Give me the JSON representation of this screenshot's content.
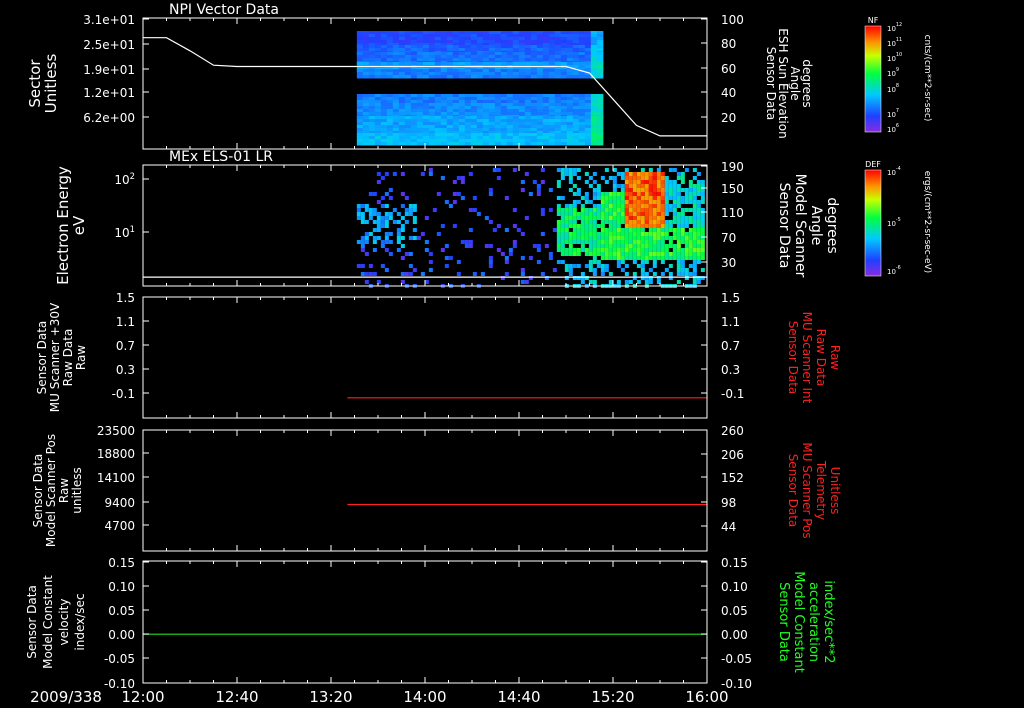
{
  "date_label": "2009/338",
  "x_ticks": [
    "12:00",
    "12:40",
    "13:20",
    "14:00",
    "14:40",
    "15:20",
    "16:00"
  ],
  "panels": [
    {
      "title": "NPI Vector Data",
      "ylabel_left": [
        "Sector",
        "Unitless"
      ],
      "yticks_left": [
        "3.1e+01",
        "2.5e+01",
        "1.9e+01",
        "1.2e+01",
        "6.2e+00"
      ],
      "ylabel_right": [
        "Sensor Data",
        "ESH Sun Elevation",
        "Angle",
        "degrees"
      ],
      "yticks_right": [
        "100",
        "80",
        "60",
        "40",
        "20"
      ],
      "colorbar": {
        "label": "NF",
        "units": "cnts/(cm**2-sr-sec)",
        "ticks": [
          "10^12",
          "10^11",
          "10^10",
          "10^9",
          "10^8",
          "10^7",
          "10^6"
        ]
      }
    },
    {
      "title": "MEx ELS-01 LR",
      "ylabel_left": [
        "Electron Energy",
        "eV"
      ],
      "yticks_left": [
        "10^2",
        "10^1"
      ],
      "ylabel_right": [
        "Sensor Data",
        "Model Scanner",
        "Angle",
        "degrees"
      ],
      "yticks_right": [
        "190",
        "150",
        "110",
        "70",
        "30"
      ],
      "colorbar": {
        "label": "DEF",
        "units": "ergs/(cm**2-sr-sec-eV)",
        "ticks": [
          "10^-4",
          "10^-5",
          "10^-6"
        ]
      }
    },
    {
      "title": "",
      "ylabel_left": [
        "Sensor Data",
        "MU Scanner +30V",
        "Raw Data",
        "Raw"
      ],
      "yticks_left": [
        "1.5",
        "1.1",
        "0.7",
        "0.3",
        "-0.1"
      ],
      "ylabel_right": [
        "Sensor Data",
        "MU Scanner Int",
        "Raw Data",
        "Raw"
      ],
      "yticks_right": [
        "1.5",
        "1.1",
        "0.7",
        "0.3",
        "-0.1"
      ]
    },
    {
      "title": "",
      "ylabel_left": [
        "Sensor Data",
        "Model Scanner Pos",
        "Raw",
        "unitless"
      ],
      "yticks_left": [
        "23500",
        "18800",
        "14100",
        "9400",
        "4700"
      ],
      "ylabel_right": [
        "Sensor Data",
        "MU Scanner Pos",
        "Telemetry",
        "Unitless"
      ],
      "yticks_right": [
        "260",
        "206",
        "152",
        "98",
        "44"
      ]
    },
    {
      "title": "",
      "ylabel_left": [
        "Sensor Data",
        "Model Constant",
        "velocity",
        "index/sec"
      ],
      "yticks_left": [
        "0.15",
        "0.10",
        "0.05",
        "0.00",
        "-0.05",
        "-0.10"
      ],
      "ylabel_right": [
        "Sensor Data",
        "Model Constant",
        "acceleration",
        "index/sec**2"
      ],
      "yticks_right": [
        "0.15",
        "0.10",
        "0.05",
        "0.00",
        "-0.05",
        "-0.10"
      ]
    }
  ],
  "colors": {
    "axis": "#ffffff",
    "panel3_right": "#ff2020",
    "panel4_right": "#ff2020",
    "panel5_right": "#20ff20",
    "line_red": "#ff2020",
    "line_green": "#20e020"
  },
  "chart_data": [
    {
      "type": "heatmap",
      "panel": "NPI Vector Data",
      "x_range": [
        "12:00",
        "16:00"
      ],
      "data_x_range": [
        "13:31",
        "15:14"
      ],
      "y_left_range": [
        0,
        31
      ],
      "y_right_range": [
        0,
        100
      ],
      "overlay_line": {
        "name": "Sensor Data ESH Sun Elevation Angle",
        "axis": "right",
        "points": [
          [
            "12:00",
            85
          ],
          [
            "12:10",
            85
          ],
          [
            "12:20",
            75
          ],
          [
            "12:30",
            64
          ],
          [
            "12:40",
            63
          ],
          [
            "15:00",
            63
          ],
          [
            "15:10",
            58
          ],
          [
            "15:20",
            38
          ],
          [
            "15:30",
            18
          ],
          [
            "15:40",
            10
          ],
          [
            "16:00",
            10
          ]
        ]
      }
    },
    {
      "type": "heatmap",
      "panel": "MEx ELS-01 LR",
      "x_range": [
        "12:00",
        "16:00"
      ],
      "data_x_range": [
        "13:31",
        "15:58"
      ],
      "y_left_scale": "log",
      "y_right_range": [
        0,
        190
      ],
      "overlay_line": {
        "name": "Sensor Data Model Scanner Angle",
        "axis": "right",
        "points": [
          [
            "12:00",
            14
          ],
          [
            "16:00",
            14
          ]
        ]
      }
    },
    {
      "type": "line",
      "panel": "MU Scanner +30V / Int",
      "y_range": [
        -0.3,
        1.5
      ],
      "series": [
        {
          "name": "Sensor Data MU Scanner Int Raw Data",
          "axis": "right",
          "points": [
            [
              "13:27",
              0.0
            ],
            [
              "16:00",
              0.0
            ]
          ]
        }
      ]
    },
    {
      "type": "line",
      "panel": "Scanner Pos",
      "y_range": [
        0,
        23500
      ],
      "series": [
        {
          "name": "Sensor Data MU Scanner Pos Telemetry",
          "axis": "right",
          "points": [
            [
              "13:27",
              100
            ],
            [
              "16:00",
              100
            ]
          ]
        }
      ]
    },
    {
      "type": "line",
      "panel": "Model Constant",
      "y_range": [
        -0.1,
        0.15
      ],
      "series": [
        {
          "name": "Sensor Data Model Constant acceleration",
          "axis": "right",
          "points": [
            [
              "12:00",
              0.0
            ],
            [
              "16:00",
              0.0
            ]
          ]
        }
      ]
    }
  ]
}
